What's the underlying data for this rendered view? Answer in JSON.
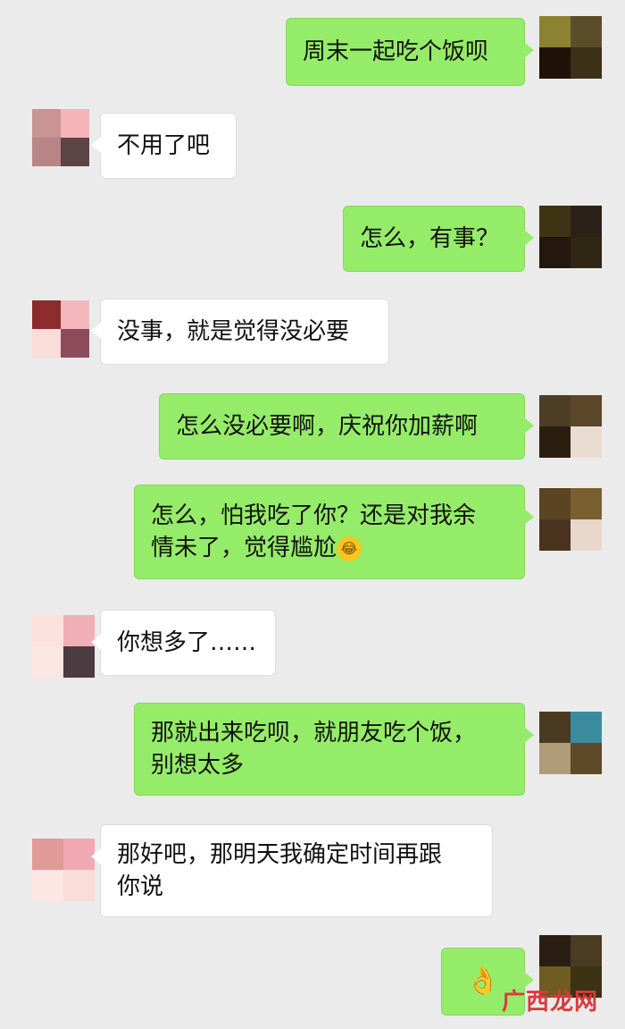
{
  "messages": [
    {
      "side": "out",
      "text": "周末一起吃个饭呗"
    },
    {
      "side": "in",
      "text": "不用了吧"
    },
    {
      "side": "out",
      "text": "怎么，有事？"
    },
    {
      "side": "in",
      "text": "没事，就是觉得没必要"
    },
    {
      "side": "out",
      "text": "怎么没必要啊，庆祝你加薪啊"
    },
    {
      "side": "out",
      "line1": "怎么，怕我吃了你？还是对我余",
      "line2": "情未了，觉得尴尬",
      "emoji": "laughing-tears-emoji"
    },
    {
      "side": "in",
      "text": "你想多了……"
    },
    {
      "side": "out",
      "line1": "那就出来吃呗，就朋友吃个饭，",
      "line2": "别想太多"
    },
    {
      "side": "in",
      "line1": "那好吧，那明天我确定时间再跟",
      "line2": "你说"
    },
    {
      "side": "out",
      "emoji": "ok-hand-emoji"
    }
  ],
  "avatar_colors": {
    "out_a": [
      "#8c8232",
      "#5c4d2a",
      "#1e1208",
      "#3c3018"
    ],
    "out_b": [
      "#3e3414",
      "#2a2218",
      "#24180e",
      "#302614"
    ],
    "out_c": [
      "#4e3e26",
      "#5a4628",
      "#2a1e10",
      "#e8dcd0"
    ],
    "out_d": [
      "#5a4422",
      "#7a6030",
      "#4a3420",
      "#e8d8cc"
    ],
    "out_e": [
      "#4a3a22",
      "#3c8ca0",
      "#b09c78",
      "#5e4a28"
    ],
    "out_f": [
      "#2a1e12",
      "#4a3c22",
      "#6e5c22",
      "#3c3214"
    ],
    "in_a": [
      "#c89494",
      "#f4b4b8",
      "#b88686",
      "#5a4444"
    ],
    "in_b": [
      "#8c2c2c",
      "#f4b8bc",
      "#fadcd8",
      "#8c4c5c"
    ],
    "in_c": [
      "#fce2de",
      "#f2aeb6",
      "#fbe6e2",
      "#4a3c40"
    ],
    "in_d": [
      "#e09a98",
      "#f2a8b2",
      "#fce6e2",
      "#fadcd8"
    ]
  },
  "watermark": "广西龙网"
}
